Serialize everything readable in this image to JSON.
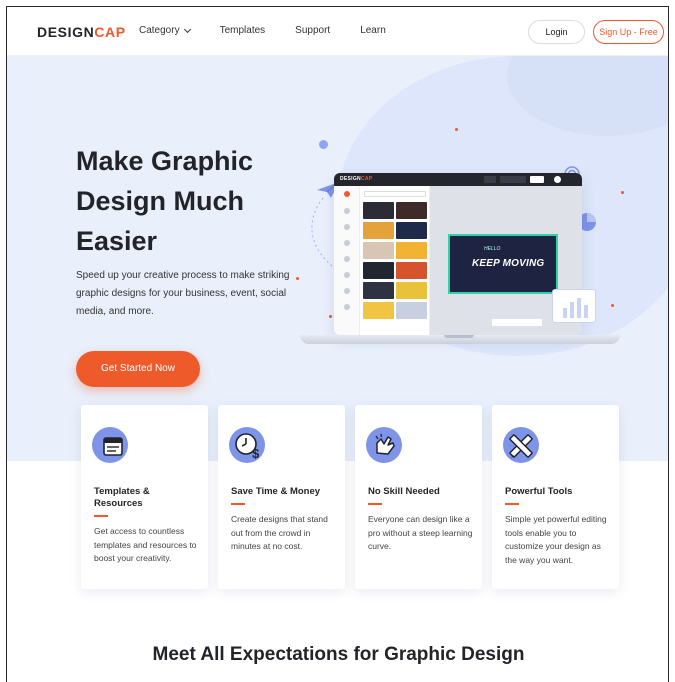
{
  "header": {
    "logo_part1": "DESIGN",
    "logo_part2": "CAP",
    "nav": [
      {
        "label": "Category"
      },
      {
        "label": "Templates"
      },
      {
        "label": "Support"
      },
      {
        "label": "Learn"
      }
    ],
    "login_label": "Login",
    "signup_label": "Sign Up - Free"
  },
  "hero": {
    "title": "Make Graphic Design Much Easier",
    "subtitle": "Speed up your creative process to make striking graphic designs for your business, event, social media, and more.",
    "cta_label": "Get Started Now",
    "mockup": {
      "app_logo_part1": "DESIGN",
      "app_logo_part2": "CAP",
      "canvas_text": "KEEP MOVING",
      "canvas_small_text": "HELLO"
    }
  },
  "features": [
    {
      "icon": "templates-icon",
      "title": "Templates & Resources",
      "text": "Get access to countless templates and resources to boost your creativity."
    },
    {
      "icon": "time-money-icon",
      "title": "Save Time & Money",
      "text": "Create designs that stand out from the crowd in minutes at no cost."
    },
    {
      "icon": "hand-icon",
      "title": "No Skill Needed",
      "text": "Everyone can design like a pro without a steep learning curve."
    },
    {
      "icon": "tools-icon",
      "title": "Powerful Tools",
      "text": "Simple yet powerful editing tools enable you to customize your design as the way you want."
    }
  ],
  "section_title": "Meet All Expectations for Graphic Design",
  "colors": {
    "accent": "#ef5a2a",
    "dark": "#23242a",
    "hero_bg": "#eaf0fb",
    "icon_bg": "#7e94e9"
  }
}
